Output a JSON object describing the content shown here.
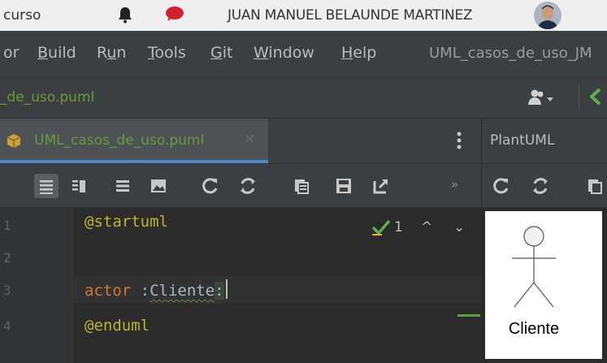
{
  "topbar": {
    "course": "curso",
    "user_name": "JUAN MANUEL BELAUNDE MARTINEZ"
  },
  "menu": {
    "items": [
      {
        "label": "or",
        "mnemonic": ""
      },
      {
        "label": "Build",
        "mnemonic": "B"
      },
      {
        "label": "Run",
        "mnemonic": "u"
      },
      {
        "label": "Tools",
        "mnemonic": "T"
      },
      {
        "label": "Git",
        "mnemonic": "G"
      },
      {
        "label": "Window",
        "mnemonic": "W"
      },
      {
        "label": "Help",
        "mnemonic": "H"
      }
    ],
    "window_title": "UML_casos_de_uso_JM"
  },
  "navbar": {
    "breadcrumb": "_de_uso.puml"
  },
  "tabs": {
    "editor_tab": "UML_casos_de_uso.puml",
    "close_glyph": "×",
    "preview_tab": "PlantUML"
  },
  "toolbar": {
    "more_glyph": "»"
  },
  "editor": {
    "line_numbers": [
      "1",
      "2",
      "3",
      "4"
    ],
    "line1": "@startuml",
    "line3_keyword": "actor",
    "line3_prefix": " :",
    "line3_ident": "Cliente",
    "line3_suffix": ":",
    "line4": "@enduml",
    "inspections_count": "1",
    "up_glyph": "^",
    "down_glyph": "⌄"
  },
  "preview": {
    "actor_name": "Cliente"
  },
  "colors": {
    "accent_blue": "#4a88c7",
    "green_text": "#6a9a3e",
    "keyword_orange": "#cc7832",
    "annotation_yellow": "#bbb529"
  }
}
